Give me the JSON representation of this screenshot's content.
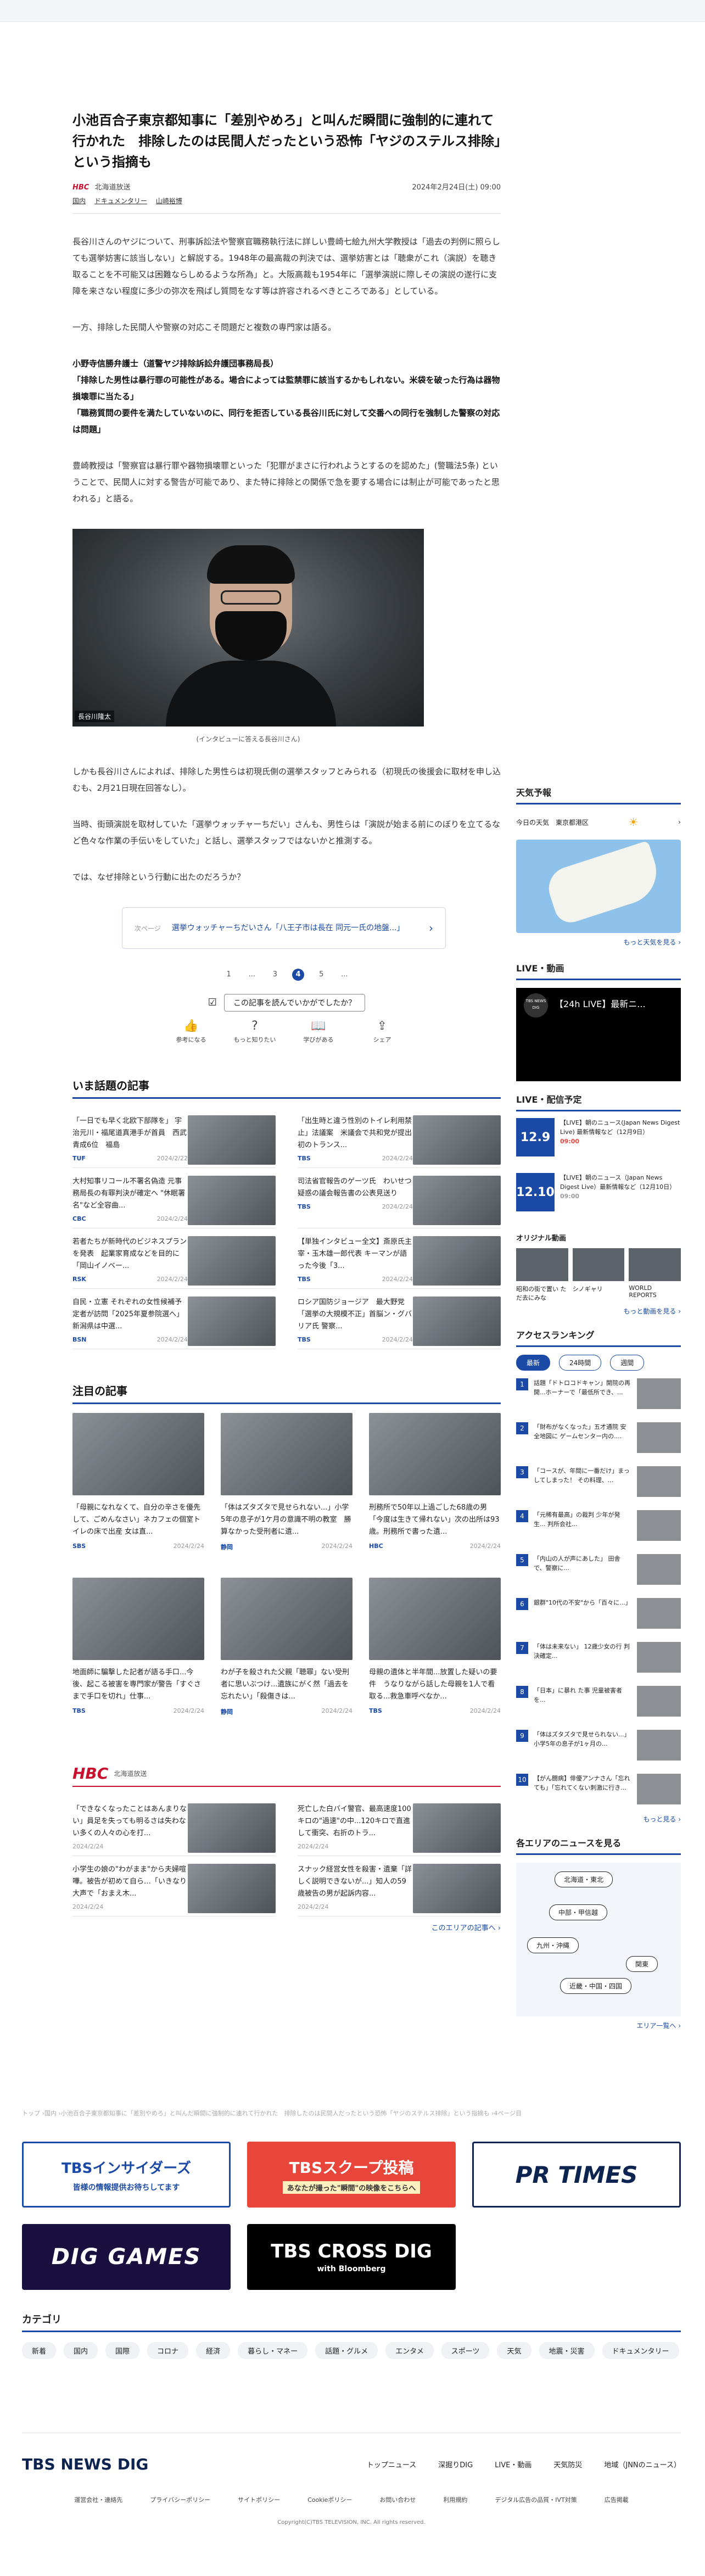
{
  "article": {
    "title": "小池百合子東京都知事に「差別やめろ」と叫んだ瞬間に強制的に連れて行かれた　排除したのは民間人だったという恐怖「ヤジのステルス排除」という指摘も",
    "source": "北海道放送",
    "date": "2024年2月24日(土) 09:00",
    "tags": [
      "国内",
      "ドキュメンタリー",
      "山崎裕博"
    ],
    "paragraphs": [
      "長谷川さんのヤジについて、刑事訴訟法や警察官職務執行法に詳しい豊崎七絵九州大学教授は「過去の判例に照らしても選挙妨害に該当しない」と解説する。1948年の最高裁の判決では、選挙妨害とは「聴衆がこれ（演説）を聴き取ることを不可能又は困難ならしめるような所為」と。大阪高裁も1954年に「選挙演説に際しその演説の遂行に支障を来さない程度に多少の弥次を飛ばし質問をなす等は許容されるべきところである」としている。",
      "一方、排除した民間人や警察の対応こそ問題だと複数の専門家は語る。"
    ],
    "bold_para": [
      "小野寺信勝弁護士（道警ヤジ排除訴訟弁護団事務局長）",
      "「排除した男性は暴行罪の可能性がある。場合によっては監禁罪に該当するかもしれない。米袋を破った行為は器物損壊罪に当たる」",
      "「職務質問の要件を満たしていないのに、同行を拒否している長谷川氏に対して交番への同行を強制した警察の対応は問題」"
    ],
    "para3": "豊崎教授は「警察官は暴行罪や器物損壊罪といった「犯罪がまさに行われようとするのを認めた」(警職法5条) ということで、民間人に対する警告が可能であり、また特に排除との関係で急を要する場合には制止が可能であったと思われる」と語る。",
    "photo_label": "長谷川隆太",
    "photo_caption": "(インタビューに答える長谷川さん)",
    "para4": "しかも長谷川さんによれば、排除した男性らは初現氏側の選挙スタッフとみられる（初現氏の後援会に取材を申し込むも、2月21日現在回答なし）。",
    "para5": "当時、街頭演説を取材していた「選挙ウォッチャーちだい」さんも、男性らは「演説が始まる前にのぼりを立てるなど色々な作業の手伝いをしていた」と話し、選挙スタッフではないかと推測する。",
    "para6": "では、なぜ排除という行動に出たのだろうか？",
    "next_label": "次ページ",
    "next_text": "選挙ウォッチャーちだいさん「八王子市は長在 同元一氏の地盤...」",
    "pager": [
      "1",
      "...",
      "3",
      "4",
      "5",
      "..."
    ],
    "pager_current": "4",
    "feedback_q": "この記事を読んでいかがでしたか？",
    "reactions": [
      "参考になる",
      "もっと知りたい",
      "学びがある",
      "シェア"
    ]
  },
  "trending": {
    "heading": "いま話題の記事",
    "items": [
      {
        "t": "「一日でも早く北欧下部隊を」 宇治元川・福尾道真港手が首員　西武青成6位　福島",
        "s": "TUF",
        "d": "2024/2/22"
      },
      {
        "t": "「出生時と違う性別のトイレ利用禁止」法議案　米議会で共和党が提出　初のトランス...",
        "s": "TBS",
        "d": "2024/2/24"
      },
      {
        "t": "大村知事リコール不署名偽造 元事務局長の有罪判決が確定へ \"休眠署名\"など全容曲...",
        "s": "CBC",
        "d": "2024/2/24"
      },
      {
        "t": "司法省官報告のゲーツ氏　わいせつ疑惑の議会報告書の公表見送り",
        "s": "TBS",
        "d": "2024/2/24"
      },
      {
        "t": "若者たちが新時代のビジネスプランを発表　起業家育成などを目的に「岡山イノベー...",
        "s": "RSK",
        "d": "2024/2/24"
      },
      {
        "t": "【単独インタビュー全文】斎原氏主宰・玉木雄一郎代表 キーマンが語った今後「3...",
        "s": "TBS",
        "d": "2024/2/24"
      },
      {
        "t": "自民・立憲 それぞれの女性候補予定者が訪問「2025年夏参院選へ」新潟県は中選...",
        "s": "BSN",
        "d": "2024/2/24"
      },
      {
        "t": "ロシア国防ジョージア　最大野党「選挙の大規模不正」首脳ン・グバリア氏 警察...",
        "s": "TBS",
        "d": "2024/2/24"
      }
    ]
  },
  "featured": {
    "heading": "注目の記事",
    "items": [
      {
        "t": "「母親になれなくて、自分の辛さを優先して、ごめんなさい」ネカフェの個室トイレの床で出産 女は直...",
        "s": "SBS",
        "d": "2024/2/24"
      },
      {
        "t": "「体はズタズタで見せられない...」小学5年の息子が1ケ月の意識不明の教室　勝算なかった受刑者に遺...",
        "s": "静岡",
        "d": "2024/2/24"
      },
      {
        "t": "刑務所で50年以上過ごした68歳の男「今度は生きて帰れない」次の出所は93歳。刑務所で書った遺...",
        "s": "HBC",
        "d": "2024/2/24"
      },
      {
        "t": "地面師に騙撃した記者が語る手口...今後、起こる被害を専門家が警告「すぐさまで手口を切れ」仕事...",
        "s": "TBS",
        "d": "2024/2/24"
      },
      {
        "t": "わが子を殺された父親「聴罪」ない受刑者に思いぶつけ...遺族にがく然「過去を忘れたい」「殺傷きは...",
        "s": "静岡",
        "d": "2024/2/24"
      },
      {
        "t": "母親の遺体と半年間...放置した疑いの要件　うなりながら話した母親を1人で看取る...救急車呼べなか...",
        "s": "TBS",
        "d": "2024/2/24"
      }
    ]
  },
  "hbc": {
    "logo": "HBC",
    "name": "北海道放送",
    "items": [
      {
        "t": "「できなくなったことはあんまりない」員足を失っても明るさは失わない多くの人々の心を打...",
        "d": "2024/2/24"
      },
      {
        "t": "死亡した白バイ警官、最高速度100キロの\"過速\"の中...120キロで直進して衝突、右折のトラ...",
        "d": "2024/2/24"
      },
      {
        "t": "小学生の娘の\"わがまま\"から夫婦喧嘩。被告が初めて自ら…「いきなり大声で「おまえ木...",
        "d": "2024/2/24"
      },
      {
        "t": "スナック経営女性を殺害・遺棄「詳しく説明できないが...」知人の59歳被告の男が起訴内容...",
        "d": "2024/2/24"
      }
    ],
    "more": "このエリアの記事へ ›"
  },
  "page_note": "トップ ›国内 ›小池百合子東京都知事に「差別やめろ」と叫んだ瞬間に強制的に連れて行かれた　排除したのは民間人だったという恐怖「ヤジのステルス排除」という指摘も ›4ページ目",
  "banners": {
    "b1": "TBSインサイダーズ",
    "b1_sub": "皆様の情報提供お待ちしてます",
    "b2": "TBSスクープ投稿",
    "b2_sub": "あなたが撮った\"瞬間\"の映像をこちらへ",
    "b3": "PR TIMES",
    "b4": "DIG GAMES",
    "b5": "TBS CROSS DIG",
    "b5_sub": "with Bloomberg"
  },
  "category": {
    "heading": "カテゴリ",
    "chips": [
      "新着",
      "国内",
      "国際",
      "コロナ",
      "経済",
      "暮らし・マネー",
      "話題・グルメ",
      "エンタメ",
      "スポーツ",
      "天気",
      "地震・災害",
      "ドキュメンタリー"
    ]
  },
  "footer": {
    "logo": "TBS NEWS DIG",
    "nav": [
      "トップニュース",
      "深掘りDIG",
      "LIVE・動画",
      "天気防災",
      "地域（JNNのニュース）"
    ],
    "sub": [
      "運営会社・連絡先",
      "プライバシーポリシー",
      "サイトポリシー",
      "Cookieポリシー",
      "お問い合わせ",
      "利用規約",
      "デジタル広告の品質・IVT対策",
      "広告掲載"
    ],
    "copyright": "Copyright(C)TBS TELEVISION, INC. All rights reserved."
  },
  "sidebar": {
    "weather_heading": "天気予報",
    "weather_loc": "今日の天気　東京都港区",
    "weather_more": "もっと天気を見る ›",
    "live_heading": "LIVE・動画",
    "live_title": "【24h LIVE】最新ニ...",
    "live_badge": "TBS NEWS DIG",
    "sched_heading": "LIVE・配信予定",
    "sched": [
      {
        "date": "12.9",
        "t": "【LIVE】朝のニュース(Japan News Digest Live) 最新情報など（12月9日）",
        "time": "09:00"
      },
      {
        "date": "12.10",
        "t": "【LIVE】朝のニュース（Japan News Digest Live）最新情報など（12月10日）",
        "time": "09:00"
      }
    ],
    "orig_heading": "オリジナル動画",
    "orig_labels": [
      "昭和の街で置い ただ去にみな",
      "シノギャリ",
      "WORLD REPORTS"
    ],
    "orig_more": "もっと動画を見る ›",
    "rank_heading": "アクセスランキング",
    "rank_tabs": [
      "最新",
      "24時間",
      "週間"
    ],
    "rank": [
      {
        "n": "1",
        "t": "話題「ドトロコドキャン」開院の再開...ホーナーで「最低所でき、..."
      },
      {
        "n": "2",
        "t": "「財布がなくなった」五才通院 安全地図に ゲームセンター内の...."
      },
      {
        "n": "3",
        "t": "「コースが、年間に一番だけ」まっしてしまった！ その料理、..."
      },
      {
        "n": "4",
        "t": "「元稀有最高」の裁判 少年が発生... 判所会社..."
      },
      {
        "n": "5",
        "t": "「内山の人が声にあした」 田舎 で、警察に..."
      },
      {
        "n": "6",
        "t": "銀群\"10代の不安\"から「百々に...」"
      },
      {
        "n": "7",
        "t": "「体は未来ない」 12歳少女の行 判決確定..."
      },
      {
        "n": "8",
        "t": "「日本」に暴れ た事 児童被害者を..."
      },
      {
        "n": "9",
        "t": "「体はズタズタで見せられない...」小学5年の息子が1ヶ月の..."
      },
      {
        "n": "10",
        "t": "【がん闘病】俳優アンナさん「忘れても」「忘れてくない刺激に行き..."
      }
    ],
    "rank_more": "もっと見る ›",
    "area_heading": "各エリアのニュースを見る",
    "areas": [
      "北海道・東北",
      "中部・甲信越",
      "九州・沖縄",
      "関東",
      "近畿・中国・四国"
    ],
    "area_more": "エリア一覧へ ›"
  }
}
